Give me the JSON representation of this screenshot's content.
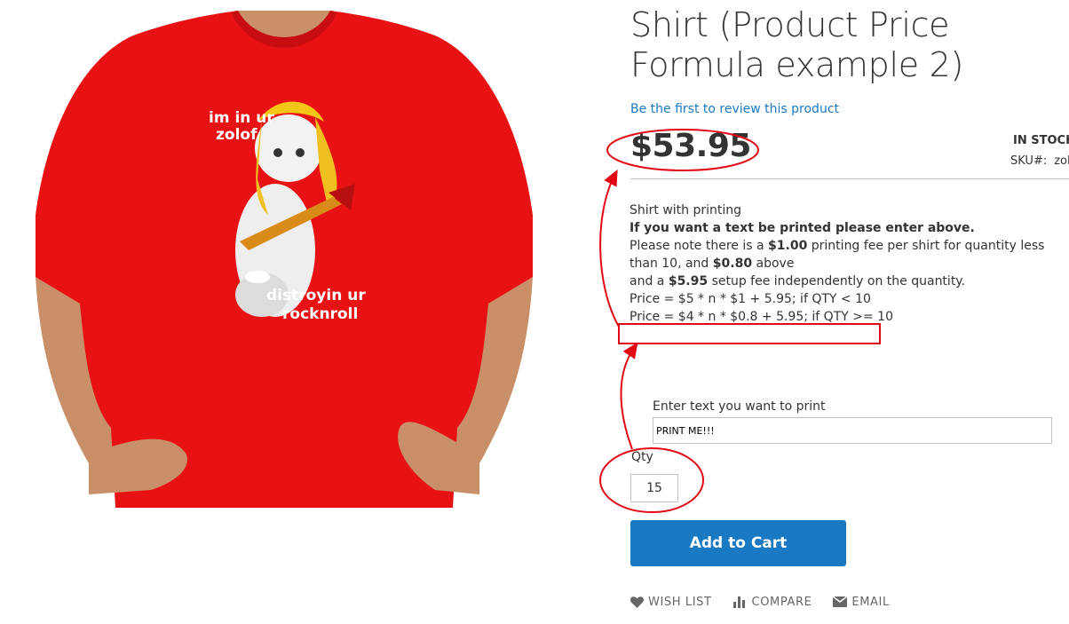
{
  "product": {
    "title": "Shirt (Product Price Formula example 2)",
    "review_link": "Be the first to review this product",
    "price": "$53.95",
    "stock": "IN STOCK",
    "sku_label": "SKU#:",
    "sku_value": "zol"
  },
  "image": {
    "shirt_color": "#e81214",
    "text_top": [
      "im in ur",
      "zolof"
    ],
    "text_bottom": [
      "distroyin ur",
      "rocknroll"
    ]
  },
  "description": {
    "line1": "Shirt with printing",
    "line2": "If you want a text be printed please enter above.",
    "line3_a": "Please note there is a ",
    "line3_fee": "$1.00",
    "line3_b": " printing fee per shirt for quantity less than 10, and ",
    "line3_fee2": "$0.80",
    "line3_c": " above",
    "line4_a": "and a ",
    "line4_fee": "$5.95",
    "line4_b": " setup fee independently on the quantity.",
    "formula1": "Price = $5 * n * $1 + 5.95; if QTY < 10",
    "formula2": "Price = $4 * n * $0.8 + 5.95; if QTY >= 10"
  },
  "form": {
    "print_text_label": "Enter text you want to print",
    "print_text_value": "PRINT ME!!!",
    "qty_label": "Qty",
    "qty_value": "15",
    "add_to_cart": "Add to Cart"
  },
  "actions": {
    "wishlist": "Wish List",
    "compare": "Compare",
    "email": "Email"
  },
  "colors": {
    "accent": "#1979c3",
    "annotation": "#e30613"
  }
}
